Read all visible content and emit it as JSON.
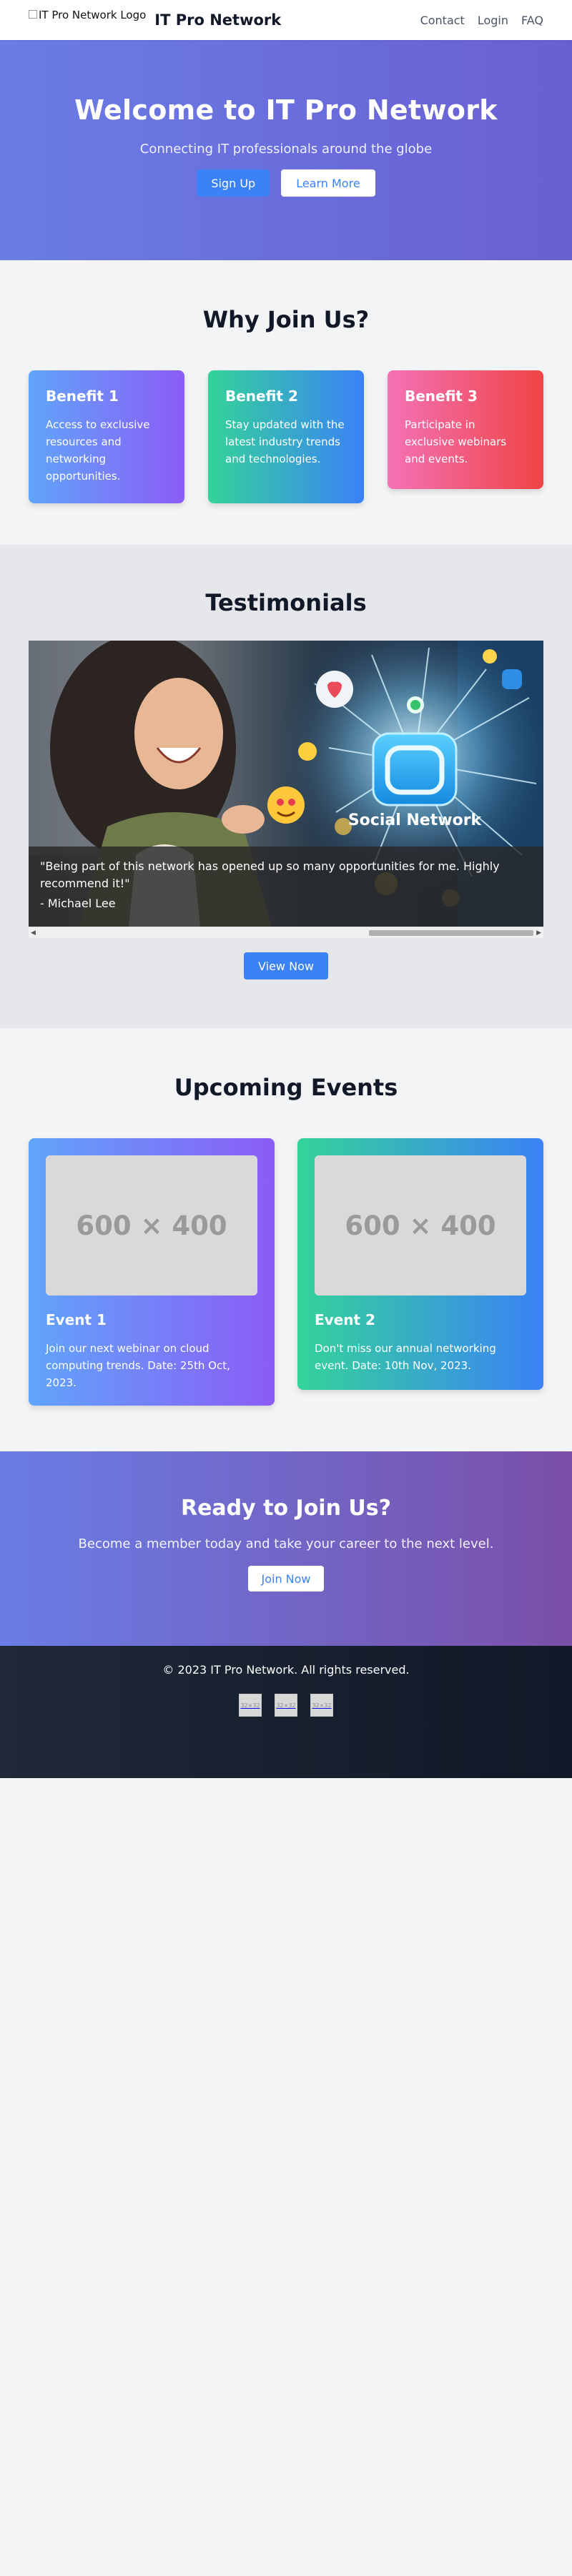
{
  "header": {
    "logo_alt": "IT Pro Network Logo",
    "title": "IT Pro Network",
    "nav": [
      "Contact",
      "Login",
      "FAQ"
    ]
  },
  "hero": {
    "title": "Welcome to IT Pro Network",
    "subtitle": "Connecting IT professionals around the globe",
    "signup_label": "Sign Up",
    "learn_label": "Learn More"
  },
  "benefits": {
    "title": "Why Join Us?",
    "items": [
      {
        "title": "Benefit 1",
        "text": "Access to exclusive resources and networking opportunities."
      },
      {
        "title": "Benefit 2",
        "text": "Stay updated with the latest industry trends and technologies."
      },
      {
        "title": "Benefit 3",
        "text": "Participate in exclusive webinars and events."
      }
    ]
  },
  "testimonials": {
    "title": "Testimonials",
    "image_label": "Social Network",
    "quote": "\"Being part of this network has opened up so many opportunities for me. Highly recommend it!\"",
    "author": "- Michael Lee",
    "view_label": "View Now"
  },
  "events": {
    "title": "Upcoming Events",
    "items": [
      {
        "placeholder": "600 × 400",
        "title": "Event 1",
        "text": "Join our next webinar on cloud computing trends. Date: 25th Oct, 2023."
      },
      {
        "placeholder": "600 × 400",
        "title": "Event 2",
        "text": "Don't miss our annual networking event. Date: 10th Nov, 2023."
      }
    ]
  },
  "cta": {
    "title": "Ready to Join Us?",
    "text": "Become a member today and take your career to the next level.",
    "button": "Join Now"
  },
  "footer": {
    "copyright": "© 2023 IT Pro Network. All rights reserved.",
    "socials": [
      {
        "icon": "facebook-icon",
        "placeholder": "32×32"
      },
      {
        "icon": "twitter-icon",
        "placeholder": "32×32"
      },
      {
        "icon": "linkedin-icon",
        "placeholder": "32×32"
      }
    ]
  }
}
